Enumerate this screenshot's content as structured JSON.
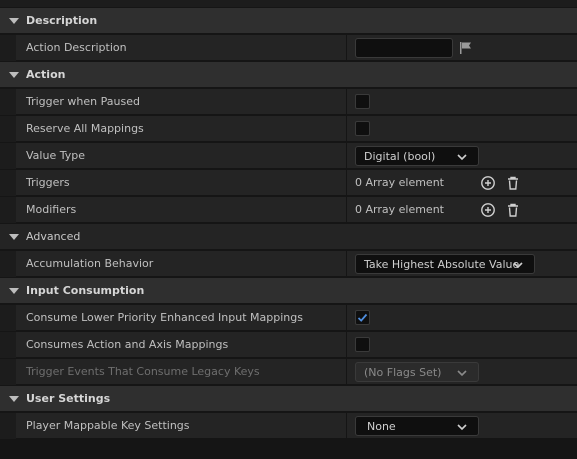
{
  "sections": {
    "description": {
      "title": "Description",
      "action_description": {
        "label": "Action Description",
        "value": ""
      }
    },
    "action": {
      "title": "Action",
      "trigger_when_paused": {
        "label": "Trigger when Paused",
        "checked": false
      },
      "reserve_all_mappings": {
        "label": "Reserve All Mappings",
        "checked": false
      },
      "value_type": {
        "label": "Value Type",
        "selected": "Digital (bool)"
      },
      "triggers": {
        "label": "Triggers",
        "value": "0 Array element"
      },
      "modifiers": {
        "label": "Modifiers",
        "value": "0 Array element"
      },
      "advanced": {
        "title": "Advanced",
        "accumulation_behavior": {
          "label": "Accumulation Behavior",
          "selected": "Take Highest Absolute Value"
        }
      }
    },
    "input_consumption": {
      "title": "Input Consumption",
      "consume_lower_priority": {
        "label": "Consume Lower Priority Enhanced Input Mappings",
        "checked": true
      },
      "consumes_action_axis": {
        "label": "Consumes Action and Axis Mappings",
        "checked": false
      },
      "trigger_events_legacy": {
        "label": "Trigger Events That Consume Legacy Keys",
        "selected": "(No Flags Set)",
        "disabled": true
      }
    },
    "user_settings": {
      "title": "User Settings",
      "player_mappable_key_settings": {
        "label": "Player Mappable Key Settings",
        "selected": "None"
      }
    }
  },
  "icons": {
    "collapse": "triangle-down-icon",
    "flag": "flag-icon",
    "add": "plus-circle-icon",
    "delete": "trash-icon",
    "dropdown": "chevron-down-icon",
    "check": "checkmark-icon"
  },
  "colors": {
    "background": "#151515",
    "section_header": "#2f2f2f",
    "row": "#242424",
    "check_accent": "#4f8fe0"
  }
}
